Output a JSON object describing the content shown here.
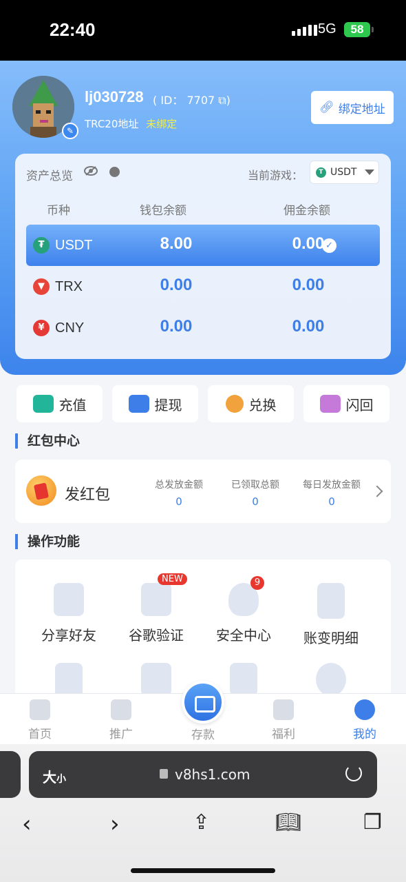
{
  "status": {
    "time": "22:40",
    "network": "5G",
    "battery": "58"
  },
  "profile": {
    "username": "lj030728",
    "id_text": "( ID： 7707 ⧉)",
    "addr_label": "TRC20地址",
    "addr_status": "未绑定",
    "bind_button": "绑定地址"
  },
  "assets": {
    "title": "资产总览",
    "game_label": "当前游戏：",
    "game_value": "USDT",
    "columns": [
      "币种",
      "钱包余额",
      "佣金余额"
    ],
    "rows": [
      {
        "coin": "USDT",
        "symbol": "₮",
        "color": "#26a17b",
        "wallet": "8.00",
        "commission": "0.00"
      },
      {
        "coin": "TRX",
        "symbol": "▼",
        "color": "#e8453a",
        "wallet": "0.00",
        "commission": "0.00"
      },
      {
        "coin": "CNY",
        "symbol": "¥",
        "color": "#e53935",
        "wallet": "0.00",
        "commission": "0.00"
      }
    ]
  },
  "actions": [
    {
      "label": "充值",
      "color": "#22b59a"
    },
    {
      "label": "提现",
      "color": "#3d7ee8"
    },
    {
      "label": "兑换",
      "color": "#f2a23c"
    },
    {
      "label": "闪回",
      "color": "#c57ad9"
    }
  ],
  "redpacket": {
    "section_title": "红包中心",
    "label": "发红包",
    "stats": [
      {
        "label": "总发放金额",
        "value": "0"
      },
      {
        "label": "已领取总额",
        "value": "0"
      },
      {
        "label": "每日发放金额",
        "value": "0"
      }
    ]
  },
  "functions": {
    "section_title": "操作功能",
    "items": [
      {
        "label": "分享好友",
        "icon": "share-icon"
      },
      {
        "label": "谷歌验证",
        "icon": "authenticator-icon",
        "badge": "NEW"
      },
      {
        "label": "安全中心",
        "icon": "shield-user-icon",
        "badge": "9"
      },
      {
        "label": "账变明细",
        "icon": "document-icon"
      }
    ]
  },
  "tabbar": {
    "items": [
      "首页",
      "推广",
      "存款",
      "福利",
      "我的"
    ]
  },
  "browser": {
    "aa": "大",
    "aa_small": "小",
    "url": "v8hs1.com"
  }
}
